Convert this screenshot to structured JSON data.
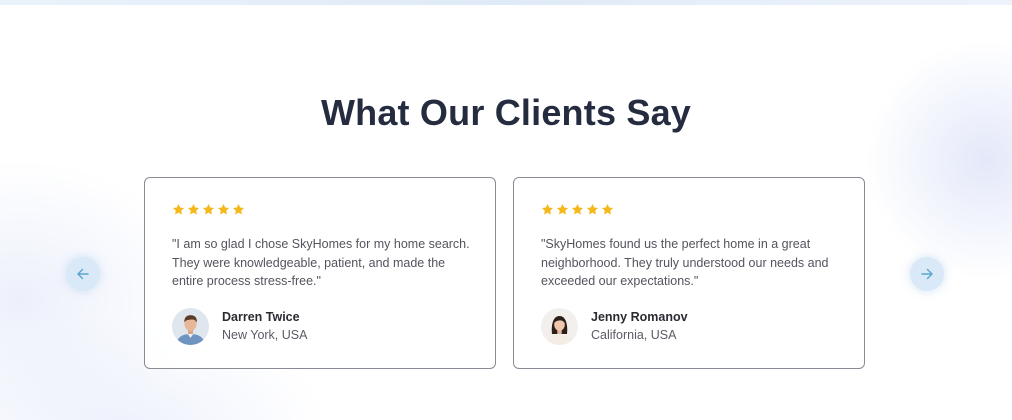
{
  "section": {
    "title": "What Our Clients Say"
  },
  "carousel": {
    "prev_icon": "arrow-left-icon",
    "next_icon": "arrow-right-icon",
    "arrow_color": "#5aa5cf",
    "button_bg": "#d9e9f7"
  },
  "testimonials": [
    {
      "rating": 5,
      "quote": "\"I am so glad I chose SkyHomes for my home search. They were knowledgeable, patient, and made the entire process stress-free.\"",
      "name": "Darren Twice",
      "location": "New York, USA",
      "avatar_icon": "avatar-man-icon"
    },
    {
      "rating": 5,
      "quote": "\"SkyHomes found us the perfect home in a great neighborhood. They truly understood our needs and exceeded our expectations.\"",
      "name": "Jenny Romanov",
      "location": "California, USA",
      "avatar_icon": "avatar-woman-icon"
    }
  ],
  "colors": {
    "star": "#f5b81c",
    "title": "#262c40",
    "card_border": "#8a8a94"
  }
}
